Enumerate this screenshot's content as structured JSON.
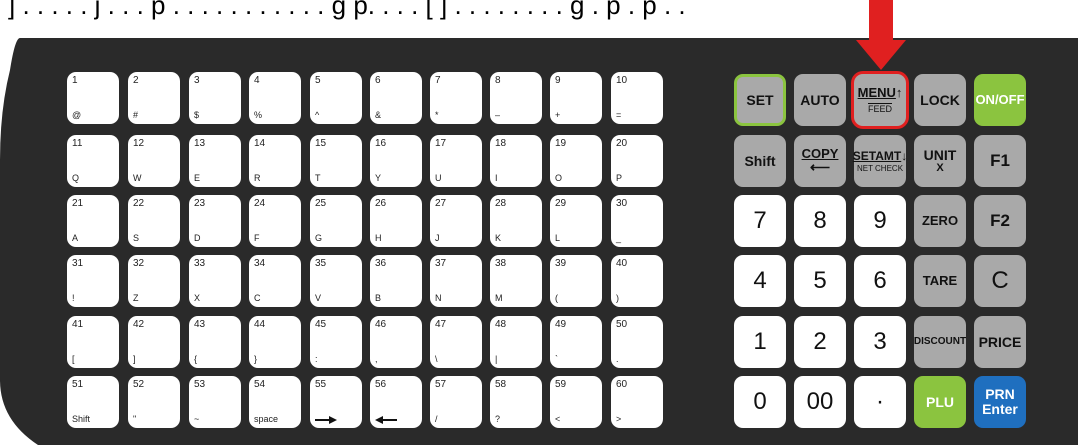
{
  "top_text": "] . . . . . j . . . p . . . . . . . . . . . g p. . . . [ ] . . . . . . . . g . p . p . .",
  "hotkeys": [
    {
      "num": "1",
      "alt": "@"
    },
    {
      "num": "2",
      "alt": "#"
    },
    {
      "num": "3",
      "alt": "$"
    },
    {
      "num": "4",
      "alt": "%"
    },
    {
      "num": "5",
      "alt": "^"
    },
    {
      "num": "6",
      "alt": "&"
    },
    {
      "num": "7",
      "alt": "*"
    },
    {
      "num": "8",
      "alt": "–"
    },
    {
      "num": "9",
      "alt": "+"
    },
    {
      "num": "10",
      "alt": "="
    },
    {
      "num": "11",
      "alt": "Q"
    },
    {
      "num": "12",
      "alt": "W"
    },
    {
      "num": "13",
      "alt": "E"
    },
    {
      "num": "14",
      "alt": "R"
    },
    {
      "num": "15",
      "alt": "T"
    },
    {
      "num": "16",
      "alt": "Y"
    },
    {
      "num": "17",
      "alt": "U"
    },
    {
      "num": "18",
      "alt": "I"
    },
    {
      "num": "19",
      "alt": "O"
    },
    {
      "num": "20",
      "alt": "P"
    },
    {
      "num": "21",
      "alt": "A"
    },
    {
      "num": "22",
      "alt": "S"
    },
    {
      "num": "23",
      "alt": "D"
    },
    {
      "num": "24",
      "alt": "F"
    },
    {
      "num": "25",
      "alt": "G"
    },
    {
      "num": "26",
      "alt": "H"
    },
    {
      "num": "27",
      "alt": "J"
    },
    {
      "num": "28",
      "alt": "K"
    },
    {
      "num": "29",
      "alt": "L"
    },
    {
      "num": "30",
      "alt": "_"
    },
    {
      "num": "31",
      "alt": "!"
    },
    {
      "num": "32",
      "alt": "Z"
    },
    {
      "num": "33",
      "alt": "X"
    },
    {
      "num": "34",
      "alt": "C"
    },
    {
      "num": "35",
      "alt": "V"
    },
    {
      "num": "36",
      "alt": "B"
    },
    {
      "num": "37",
      "alt": "N"
    },
    {
      "num": "38",
      "alt": "M"
    },
    {
      "num": "39",
      "alt": "("
    },
    {
      "num": "40",
      "alt": ")"
    },
    {
      "num": "41",
      "alt": "["
    },
    {
      "num": "42",
      "alt": "]"
    },
    {
      "num": "43",
      "alt": "{"
    },
    {
      "num": "44",
      "alt": "}"
    },
    {
      "num": "45",
      "alt": ":"
    },
    {
      "num": "46",
      "alt": ","
    },
    {
      "num": "47",
      "alt": "\\"
    },
    {
      "num": "48",
      "alt": "|"
    },
    {
      "num": "49",
      "alt": "`"
    },
    {
      "num": "50",
      "alt": "."
    },
    {
      "num": "51",
      "alt": "Shift"
    },
    {
      "num": "52",
      "alt": "\""
    },
    {
      "num": "53",
      "alt": "~"
    },
    {
      "num": "54",
      "alt": "space"
    },
    {
      "num": "55",
      "alt": "right-arrow-icon"
    },
    {
      "num": "56",
      "alt": "left-arrow-icon"
    },
    {
      "num": "57",
      "alt": "/"
    },
    {
      "num": "58",
      "alt": "?"
    },
    {
      "num": "59",
      "alt": "<"
    },
    {
      "num": "60",
      "alt": ">"
    }
  ],
  "func_keys": {
    "set": "SET",
    "auto": "AUTO",
    "menu": {
      "main": "MENU",
      "arrow": "↑",
      "sub": "FEED"
    },
    "lock": "LOCK",
    "onoff": "ON/OFF",
    "shift": "Shift",
    "copy": {
      "main": "COPY",
      "arrow": "⟵"
    },
    "setamt": {
      "main": "SETAMT",
      "arrow": "↓",
      "sub": "NET CHECK"
    },
    "unit": {
      "main": "UNIT",
      "sub": "X"
    },
    "f1": "F1",
    "f2": "F2",
    "zero": "ZERO",
    "tare": "TARE",
    "c": "C",
    "discount": "DISCOUNT",
    "price": "PRICE",
    "plu": "PLU",
    "prn": {
      "line1": "PRN",
      "line2": "Enter"
    }
  },
  "numpad": [
    "7",
    "8",
    "9",
    "4",
    "5",
    "6",
    "1",
    "2",
    "3",
    "0",
    "00",
    "·"
  ],
  "colors": {
    "panel": "#2a2a2a",
    "function_key": "#a9a9a9",
    "green_key": "#8bc43f",
    "blue_key": "#1f6fbf",
    "highlight": "#e02020"
  }
}
